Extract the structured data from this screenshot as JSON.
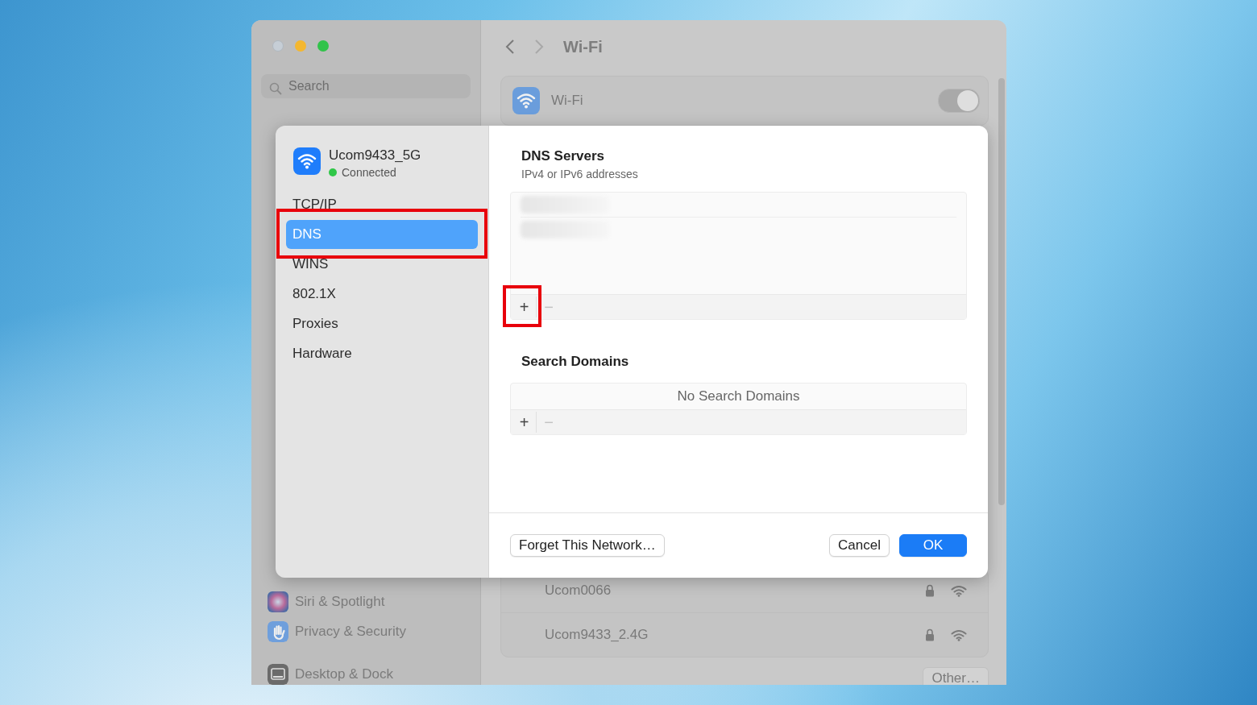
{
  "sidebar": {
    "search": {
      "placeholder": "Search"
    },
    "items": [
      {
        "label": "Siri & Spotlight",
        "kind": "siri"
      },
      {
        "label": "Privacy & Security",
        "kind": "privacy"
      },
      {
        "label": "Desktop & Dock",
        "kind": "dock"
      }
    ]
  },
  "header": {
    "title": "Wi-Fi"
  },
  "wifi_card": {
    "label": "Wi-Fi",
    "on": true
  },
  "networks": [
    {
      "name": "Ucom0066",
      "locked": true
    },
    {
      "name": "Ucom9433_2.4G",
      "locked": true
    }
  ],
  "other_button": "Other…",
  "dialog": {
    "network": {
      "name": "Ucom9433_5G",
      "status": "Connected"
    },
    "nav": [
      {
        "label": "TCP/IP",
        "selected": false,
        "highlighted": false
      },
      {
        "label": "DNS",
        "selected": true,
        "highlighted": true
      },
      {
        "label": "WINS",
        "selected": false,
        "highlighted": false
      },
      {
        "label": "802.1X",
        "selected": false,
        "highlighted": false
      },
      {
        "label": "Proxies",
        "selected": false,
        "highlighted": false
      },
      {
        "label": "Hardware",
        "selected": false,
        "highlighted": false
      }
    ],
    "dns_servers": {
      "title": "DNS Servers",
      "subtitle": "IPv4 or IPv6 addresses",
      "entries": [
        {
          "kind": "redacted"
        },
        {
          "kind": "redacted"
        }
      ],
      "add_highlighted": true,
      "add": "+",
      "remove": "−"
    },
    "search_domains": {
      "title": "Search Domains",
      "empty_text": "No Search Domains",
      "add": "+",
      "remove": "−"
    },
    "buttons": {
      "forget": "Forget This Network…",
      "cancel": "Cancel",
      "ok": "OK"
    }
  }
}
